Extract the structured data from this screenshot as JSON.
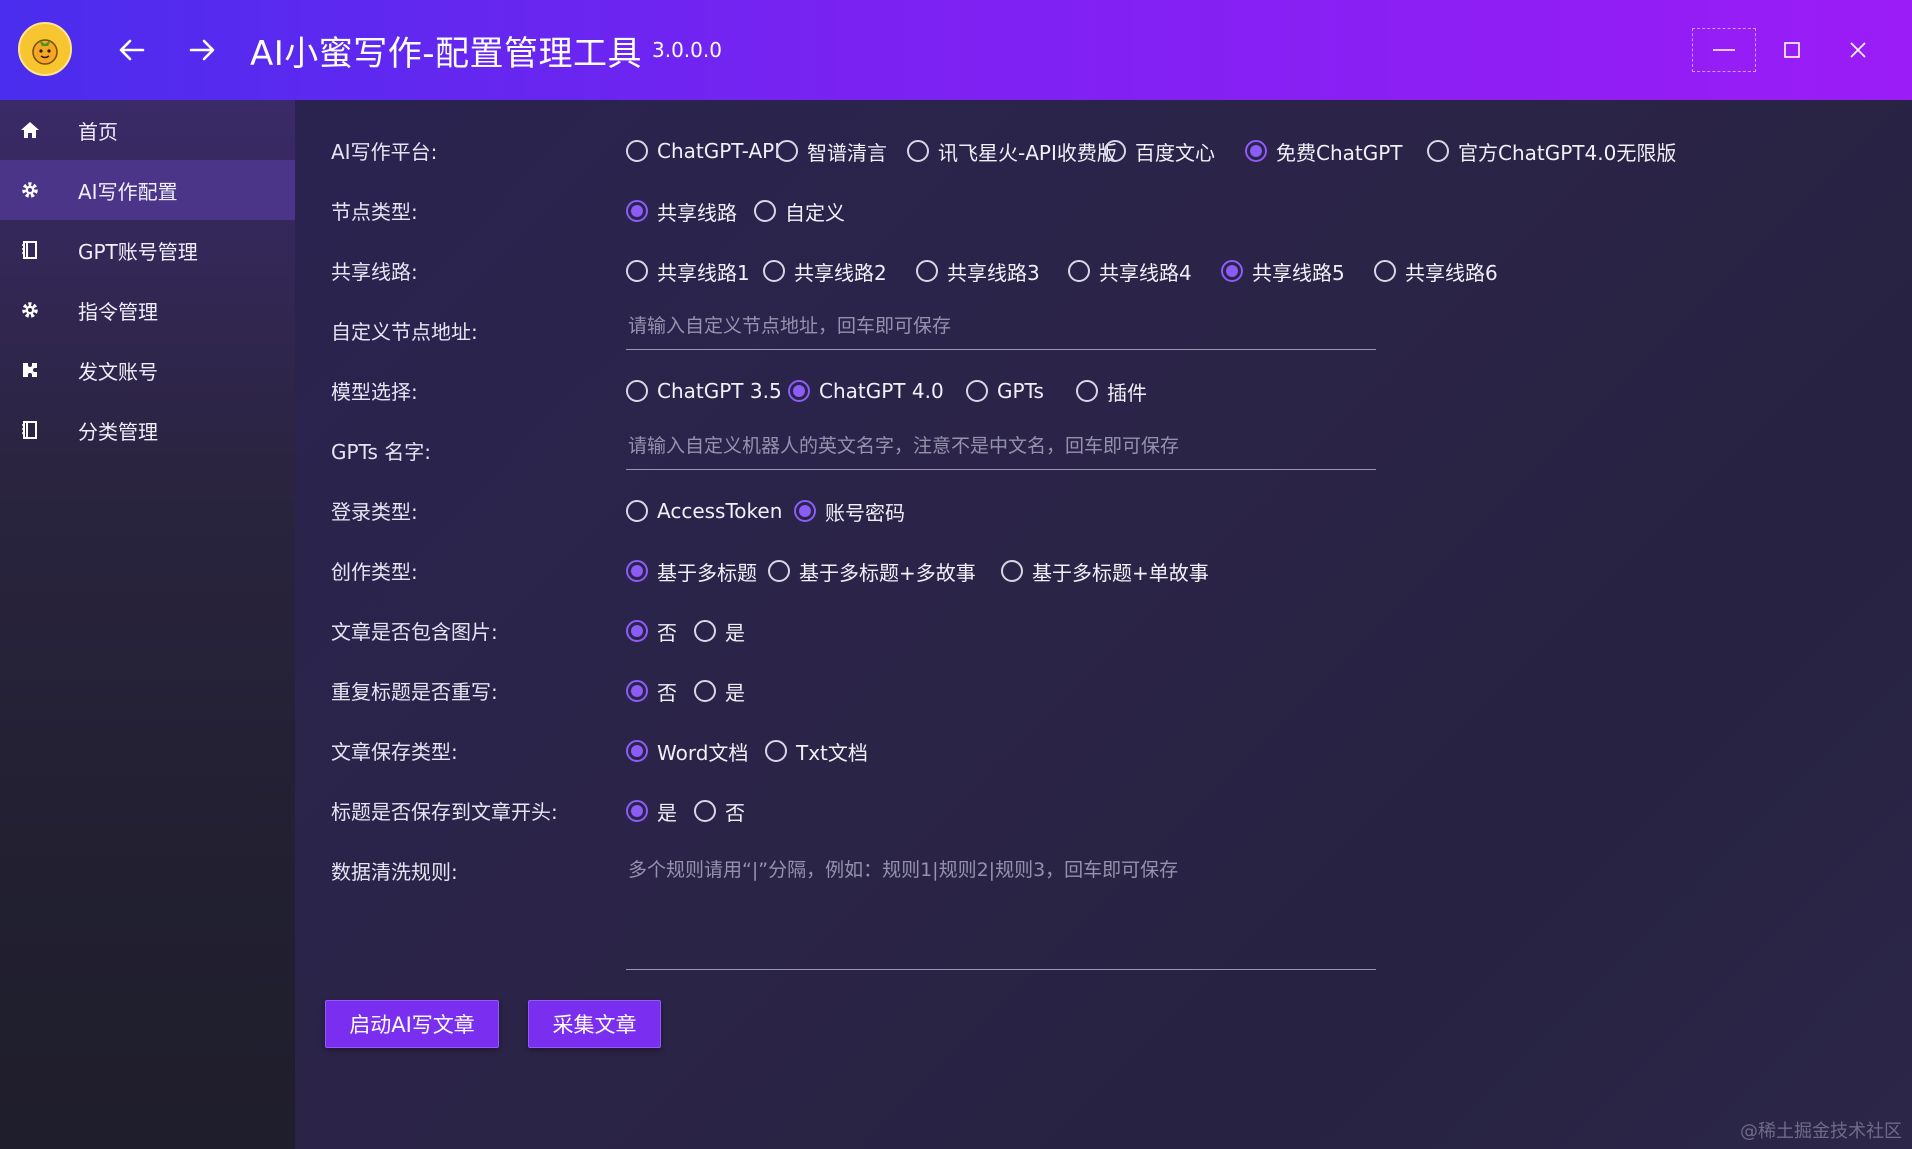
{
  "app": {
    "title": "AI小蜜写作-配置管理工具",
    "version": "3.0.0.0"
  },
  "colors": {
    "titlebar_start": "#4a2dee",
    "titlebar_end": "#9b1cf6",
    "accent": "#8b5cf6",
    "button": "#7a2ff0"
  },
  "sidebar": {
    "items": [
      {
        "label": "首页",
        "icon": "home-icon"
      },
      {
        "label": "AI写作配置",
        "icon": "gear-icon"
      },
      {
        "label": "GPT账号管理",
        "icon": "book-icon"
      },
      {
        "label": "指令管理",
        "icon": "gear-icon"
      },
      {
        "label": "发文账号",
        "icon": "puzzle-icon"
      },
      {
        "label": "分类管理",
        "icon": "book-icon"
      }
    ]
  },
  "form": {
    "platform": {
      "label": "AI写作平台:",
      "options": [
        "ChatGPT-API",
        "智谱清言",
        "讯飞星火-API收费版",
        "百度文心",
        "免费ChatGPT",
        "官方ChatGPT4.0无限版"
      ],
      "selected": "免费ChatGPT"
    },
    "node_type": {
      "label": "节点类型:",
      "options": [
        "共享线路",
        "自定义"
      ],
      "selected": "共享线路"
    },
    "shared_line": {
      "label": "共享线路:",
      "options": [
        "共享线路1",
        "共享线路2",
        "共享线路3",
        "共享线路4",
        "共享线路5",
        "共享线路6"
      ],
      "selected": "共享线路5"
    },
    "custom_node": {
      "label": "自定义节点地址:",
      "value": "",
      "placeholder": "请输入自定义节点地址，回车即可保存"
    },
    "model": {
      "label": "模型选择:",
      "options": [
        "ChatGPT 3.5",
        "ChatGPT 4.0",
        "GPTs",
        "插件"
      ],
      "selected": "ChatGPT 4.0"
    },
    "gpts_name": {
      "label": "GPTs 名字:",
      "value": "",
      "placeholder": "请输入自定义机器人的英文名字，注意不是中文名，回车即可保存"
    },
    "login_type": {
      "label": "登录类型:",
      "options": [
        "AccessToken",
        "账号密码"
      ],
      "selected": "账号密码"
    },
    "create_type": {
      "label": "创作类型:",
      "options": [
        "基于多标题",
        "基于多标题+多故事",
        "基于多标题+单故事"
      ],
      "selected": "基于多标题"
    },
    "include_image": {
      "label": "文章是否包含图片:",
      "options": [
        "否",
        "是"
      ],
      "selected": "否"
    },
    "rewrite_title": {
      "label": "重复标题是否重写:",
      "options": [
        "否",
        "是"
      ],
      "selected": "否"
    },
    "save_type": {
      "label": "文章保存类型:",
      "options": [
        "Word文档",
        "Txt文档"
      ],
      "selected": "Word文档"
    },
    "title_at_start": {
      "label": "标题是否保存到文章开头:",
      "options": [
        "是",
        "否"
      ],
      "selected": "是"
    },
    "clean_rules": {
      "label": "数据清洗规则:",
      "value": "",
      "placeholder": "多个规则请用“|”分隔，例如：规则1|规则2|规则3，回车即可保存"
    }
  },
  "buttons": {
    "start_label": "启动AI写文章",
    "collect_label": "采集文章"
  },
  "watermark": "@稀土掘金技术社区"
}
